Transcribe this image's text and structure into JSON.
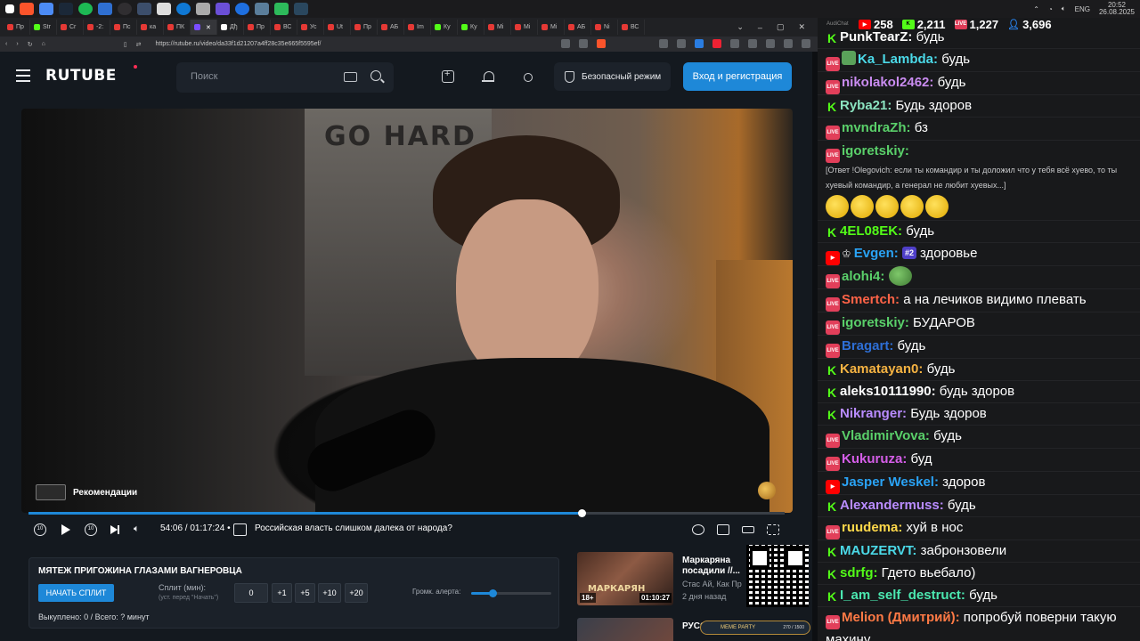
{
  "os": {
    "clock_time": "20:52",
    "clock_date": "26.08.2025",
    "lang": "ENG"
  },
  "browser": {
    "tabs": [
      {
        "label": "Пр",
        "color": "#e53935"
      },
      {
        "label": "Str",
        "color": "#53fc18"
      },
      {
        "label": "Cr",
        "color": "#e53935"
      },
      {
        "label": "-2:",
        "color": "#e53935"
      },
      {
        "label": "Пс",
        "color": "#e53935"
      },
      {
        "label": "ка",
        "color": "#e53935"
      },
      {
        "label": "ПК",
        "color": "#e53935"
      },
      {
        "label": "",
        "color": "#7b4dff"
      },
      {
        "label": "Дђ",
        "color": "#fff"
      },
      {
        "label": "Пр",
        "color": "#e53935"
      },
      {
        "label": "ВС",
        "color": "#e53935"
      },
      {
        "label": "Ус",
        "color": "#e53935"
      },
      {
        "label": "Ut",
        "color": "#e53935"
      },
      {
        "label": "Пр",
        "color": "#e53935"
      },
      {
        "label": "АБ",
        "color": "#e53935"
      },
      {
        "label": "Im",
        "color": "#e53935"
      },
      {
        "label": "Ку",
        "color": "#53fc18"
      },
      {
        "label": "Ку",
        "color": "#53fc18"
      },
      {
        "label": "Mi",
        "color": "#e53935"
      },
      {
        "label": "Mi",
        "color": "#e53935"
      },
      {
        "label": "Mi",
        "color": "#e53935"
      },
      {
        "label": "АБ",
        "color": "#e53935"
      },
      {
        "label": "Ni",
        "color": "#e53935"
      },
      {
        "label": "ВС",
        "color": "#e53935"
      }
    ],
    "url": "https://rutube.ru/video/da33f1d21207a4ff28c35e665f5595ef/"
  },
  "header": {
    "logo": "RUTUBE",
    "search_placeholder": "Поиск",
    "safe_mode": "Безопасный режим",
    "login": "Вход и регистрация"
  },
  "player": {
    "recommendations_label": "Рекомендации",
    "poster_text": "GO HARD",
    "progress_fraction": 0.7314,
    "time": "54:06 / 01:17:24",
    "bullet": "•",
    "chapter_title": "Российская власть слишком далека от народа?",
    "rewind_label": "10",
    "forward_label": "10"
  },
  "split": {
    "title": "МЯТЕЖ ПРИГОЖИНА ГЛАЗАМИ ВАГНЕРОВЦА",
    "start_button": "НАЧАТЬ СПЛИТ",
    "minutes_label": "Сплит (мин):",
    "minutes_hint": "(уст. перед \"Начать\")",
    "value": "0",
    "increments": [
      "+1",
      "+5",
      "+10",
      "+20"
    ],
    "alert_volume_label": "Громк. алерта:",
    "alert_volume_fraction": 0.27,
    "stats": "Выкуплено: 0 / Всего: ? минут"
  },
  "recommendations": [
    {
      "title": "Маркаряна посадили //...",
      "channel": "Стас Ай, Как Пр",
      "date": "2 дня назад",
      "thumb_text": "МАРКАРЯН",
      "badge": "18+",
      "duration": "01:10:27"
    },
    {
      "title": "РУССК... БОЛ...",
      "channel": "",
      "date": "",
      "thumb_text": "",
      "badge": "",
      "duration": ""
    }
  ],
  "meme_party": {
    "label": "MEME PARTY",
    "count": "270 / 1500"
  },
  "chat": {
    "app_name": "AudiChat",
    "stats": {
      "youtube": "258",
      "kick": "2,211",
      "vk": "1,227",
      "viewers": "3,696"
    },
    "messages": [
      {
        "platform": "kick",
        "nick": "PunkTearZ:",
        "nick_color": "#ffffff",
        "text": "будь"
      },
      {
        "platform": "vk",
        "nick": "Ka_Lambda:",
        "nick_color": "#4bd9e8",
        "text": "будь",
        "shield": true
      },
      {
        "platform": "vk",
        "nick": "nikolakol2462:",
        "nick_color": "#c98cf0",
        "text": "будь"
      },
      {
        "platform": "kick",
        "nick": "Ryba21:",
        "nick_color": "#8be3c0",
        "text": "Будь здоров"
      },
      {
        "platform": "vk",
        "nick": "mvndraZh:",
        "nick_color": "#5ad06a",
        "text": "бз"
      },
      {
        "platform": "vk",
        "nick": "igoretskiy:",
        "nick_color": "#5ad06a",
        "text": "",
        "reply": "[Ответ !Olegovich: если ты командир и ты доложил что у тебя всё хуево, то ты хуевый командир, а генерал не любит хуевых...]",
        "emotes": 5
      },
      {
        "platform": "kick",
        "nick": "4EL08EK:",
        "nick_color": "#53fc18",
        "text": "будь"
      },
      {
        "platform": "yt",
        "nick": "Evgen:",
        "nick_color": "#2aa3f5",
        "text": "здоровье",
        "crown": "♔",
        "badge": "#2"
      },
      {
        "platform": "vk",
        "nick": "alohi4:",
        "nick_color": "#5ad06a",
        "text": "",
        "pepe": true
      },
      {
        "platform": "vk",
        "nick": "Smertch:",
        "nick_color": "#ff6347",
        "text": "а на лечиков видимо плевать"
      },
      {
        "platform": "vk",
        "nick": "igoretskiy:",
        "nick_color": "#5ad06a",
        "text": "БУДАРОВ"
      },
      {
        "platform": "vk",
        "nick": "Bragart:",
        "nick_color": "#2e6fd6",
        "text": "будь"
      },
      {
        "platform": "kick",
        "nick": "Kamatayan0:",
        "nick_color": "#f5b342",
        "text": "будь"
      },
      {
        "platform": "kick",
        "nick": "aleks10111990:",
        "nick_color": "#ffffff",
        "text": "будь здоров"
      },
      {
        "platform": "kick",
        "nick": "Nikranger:",
        "nick_color": "#b98cff",
        "text": "Будь здоров"
      },
      {
        "platform": "vk",
        "nick": "VladimirVova:",
        "nick_color": "#5ad06a",
        "text": "будь"
      },
      {
        "platform": "vk",
        "nick": "Kukuruza:",
        "nick_color": "#d55ee8",
        "text": "буд"
      },
      {
        "platform": "yt",
        "nick": "Jasper Weskel:",
        "nick_color": "#2aa3f5",
        "text": "здоров"
      },
      {
        "platform": "kick",
        "nick": "Alexandermuss:",
        "nick_color": "#b98cff",
        "text": "будь"
      },
      {
        "platform": "vk",
        "nick": "ruudema:",
        "nick_color": "#ffd84a",
        "text": "хуй в нос"
      },
      {
        "platform": "kick",
        "nick": "MAUZERVT:",
        "nick_color": "#4bd9e8",
        "text": "забронзовели"
      },
      {
        "platform": "kick",
        "nick": "sdrfg:",
        "nick_color": "#53fc18",
        "text": "Гдето вьебало)"
      },
      {
        "platform": "kick",
        "nick": "I_am_self_destruct:",
        "nick_color": "#4be8b0",
        "text": "будь"
      },
      {
        "platform": "vk",
        "nick": "Melion (Дмитрий):",
        "nick_color": "#ff7a45",
        "text": "попробуй поверни такую махину"
      }
    ]
  }
}
